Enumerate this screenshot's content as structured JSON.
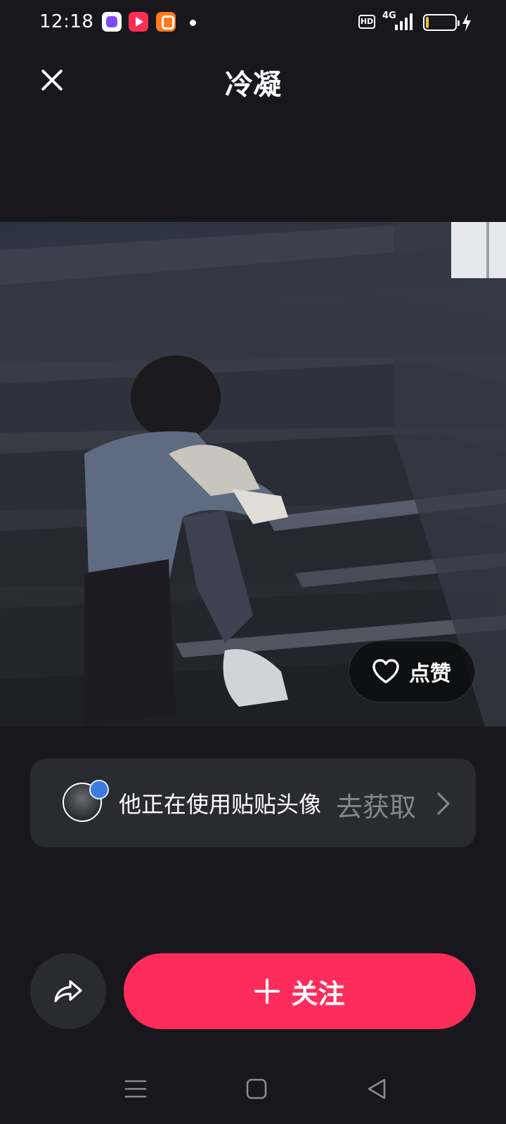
{
  "status_bar": {
    "time": "12:18",
    "hd_label": "HD",
    "network_label": "4G",
    "icons": [
      "messenger-app-icon",
      "video-app-icon",
      "kuaishou-app-icon",
      "notification-dot",
      "hd-icon",
      "signal-icon",
      "battery-icon",
      "charging-icon"
    ]
  },
  "header": {
    "title": "冷凝",
    "close_icon": "close-icon"
  },
  "photo": {
    "like_label": "点赞",
    "like_icon": "heart-icon"
  },
  "source_card": {
    "text": "他正在使用贴贴头像",
    "action": "去获取",
    "action_icon": "chevron-right-icon"
  },
  "actions": {
    "share_icon": "share-icon",
    "follow_label": "关注",
    "follow_icon": "plus-icon"
  },
  "nav_bar": {
    "icons": [
      "menu-icon",
      "home-icon",
      "back-icon"
    ]
  },
  "colors": {
    "background": "#18171e",
    "card": "#2a2a31",
    "accent": "#fe2c5b",
    "muted_text": "#85858c"
  }
}
